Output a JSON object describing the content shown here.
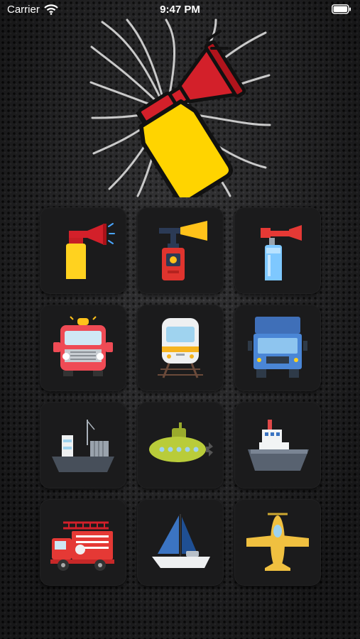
{
  "status_bar": {
    "carrier": "Carrier",
    "time": "9:47 PM"
  },
  "hero": {
    "icon": "air-horn-icon"
  },
  "sound_buttons": [
    {
      "icon": "air-horn-yellow-icon"
    },
    {
      "icon": "air-horn-red-icon"
    },
    {
      "icon": "air-horn-blue-icon"
    },
    {
      "icon": "fire-truck-front-icon"
    },
    {
      "icon": "train-icon"
    },
    {
      "icon": "truck-icon"
    },
    {
      "icon": "cargo-ship-icon"
    },
    {
      "icon": "submarine-icon"
    },
    {
      "icon": "ship-icon"
    },
    {
      "icon": "fire-engine-icon"
    },
    {
      "icon": "sailboat-icon"
    },
    {
      "icon": "airplane-icon"
    }
  ],
  "colors": {
    "background": "#2a2a2c",
    "tile": "#1b1b1c",
    "horn_red": "#d3202a",
    "can_yellow": "#ffd400"
  }
}
